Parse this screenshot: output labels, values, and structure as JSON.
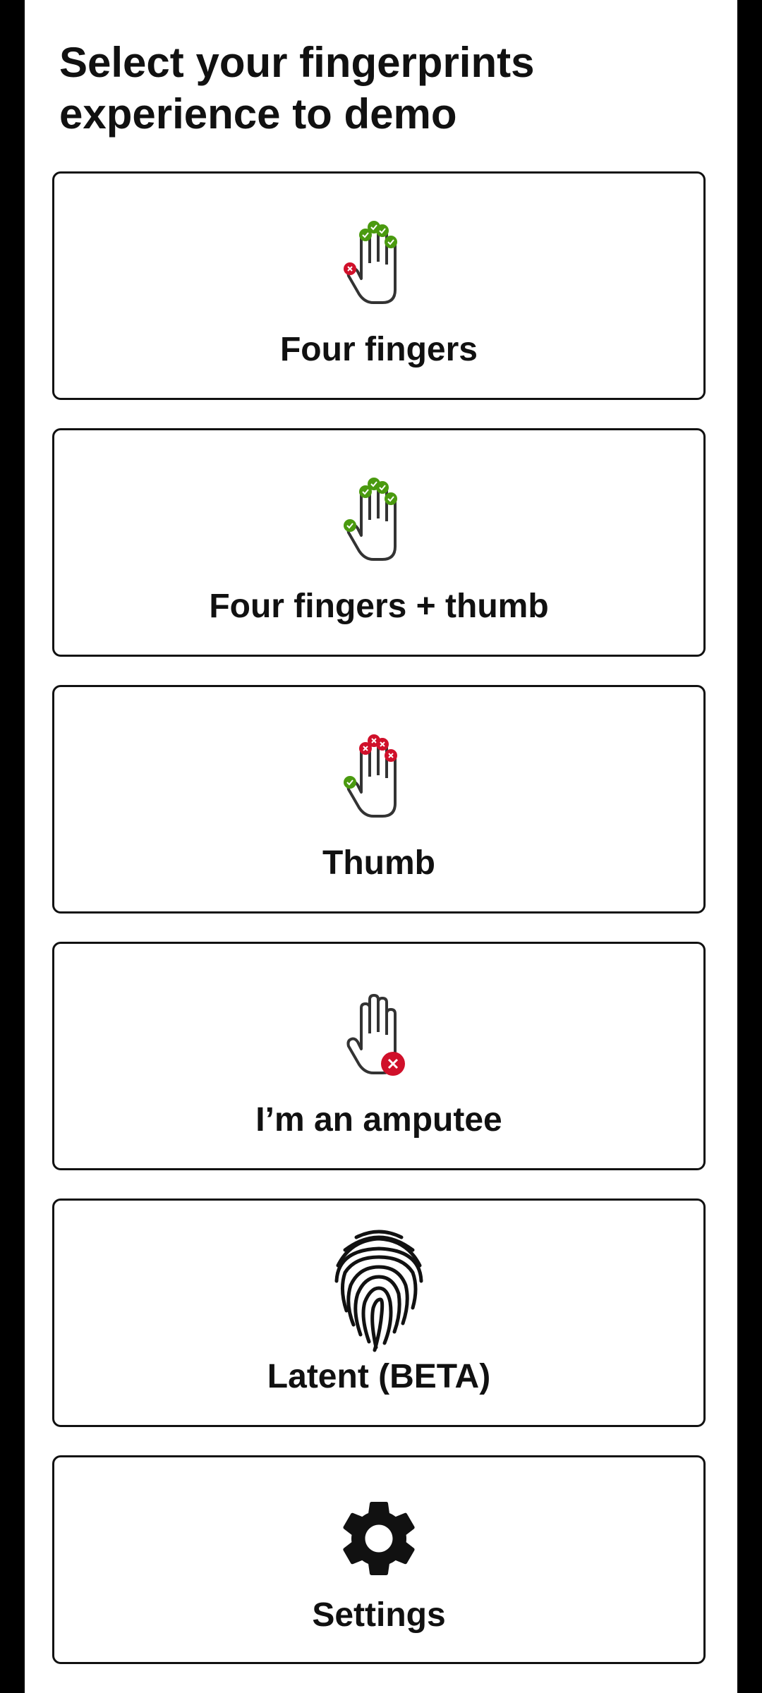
{
  "page": {
    "title_line1": "Select your fingerprints",
    "title_line2": "experience to demo"
  },
  "options": [
    {
      "label": "Four fingers",
      "icon": "hand-four-fingers-icon"
    },
    {
      "label": "Four fingers + thumb",
      "icon": "hand-four-fingers-thumb-icon"
    },
    {
      "label": "Thumb",
      "icon": "hand-thumb-icon"
    },
    {
      "label": "I’m an amputee",
      "icon": "hand-amputee-icon"
    },
    {
      "label": "Latent (BETA)",
      "icon": "fingerprint-icon"
    },
    {
      "label": "Settings",
      "icon": "gear-icon"
    }
  ],
  "colors": {
    "check_green": "#4a9a0f",
    "cross_red": "#d0102a",
    "outline": "#333333",
    "text": "#111111"
  }
}
